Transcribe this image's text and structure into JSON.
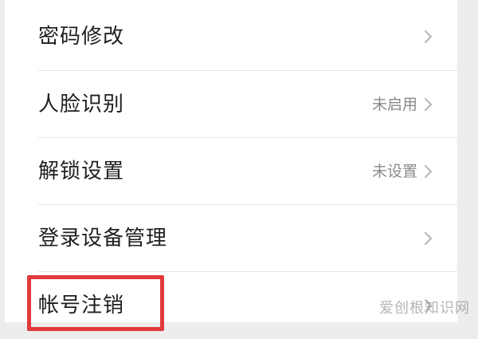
{
  "settings": {
    "items": [
      {
        "label": "密码修改",
        "value": ""
      },
      {
        "label": "人脸识别",
        "value": "未启用"
      },
      {
        "label": "解锁设置",
        "value": "未设置"
      },
      {
        "label": "登录设备管理",
        "value": ""
      },
      {
        "label": "帐号注销",
        "value": ""
      }
    ]
  },
  "watermark": {
    "text": "爱创根知识网"
  },
  "icons": {
    "chevron": "chevron-right-icon"
  },
  "colors": {
    "highlight": "#e23a3a",
    "text": "#1f1f1f",
    "secondary": "#8a8a8a",
    "chevron": "#b5b5b5"
  }
}
